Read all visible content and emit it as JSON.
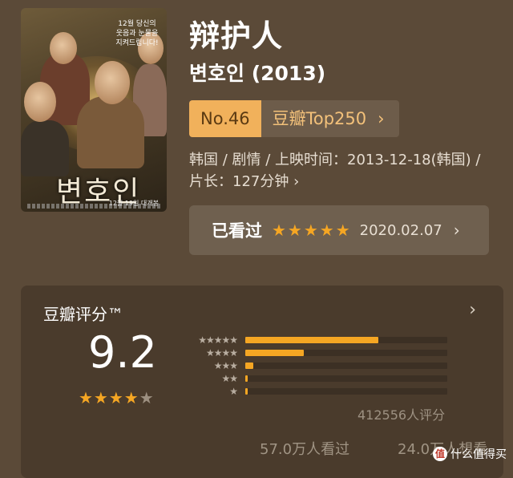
{
  "movie": {
    "title": "辩护人",
    "original_title": "변호인 (2013)",
    "rank_no": "No.46",
    "rank_list": "豆瓣Top250",
    "info": "韩国 / 剧情 / 上映时间：2013-12-18(韩国) / 片长：127分钟",
    "info_chevron": "›"
  },
  "poster": {
    "title": "변호인",
    "tagline": "12월 당신의 웃음과 눈물을 지켜드립니다!",
    "release": "12월 19일 대개봉"
  },
  "seen": {
    "label": "已看过",
    "stars": "★★★★★",
    "date": "2020.02.07",
    "chevron": "›"
  },
  "rating": {
    "heading": "豆瓣评分™",
    "score": "9.2",
    "stars_full": "★★★★",
    "stars_half": "★",
    "chevron": "›",
    "distribution": [
      {
        "level": "★★★★★",
        "percent": 0.66
      },
      {
        "level": "★★★★",
        "percent": 0.29
      },
      {
        "level": "★★★",
        "percent": 0.04
      },
      {
        "level": "★★",
        "percent": 0.004
      },
      {
        "level": "★",
        "percent": 0.002
      }
    ],
    "count": "412556人评分",
    "watched": "57.0万人看过",
    "want": "24.0万人想看"
  },
  "watermark": {
    "logo": "值",
    "text": "什么值得买"
  },
  "colors": {
    "background": "#5b4a38",
    "accent": "#f5a623",
    "rank_badge": "#f1b15b"
  }
}
